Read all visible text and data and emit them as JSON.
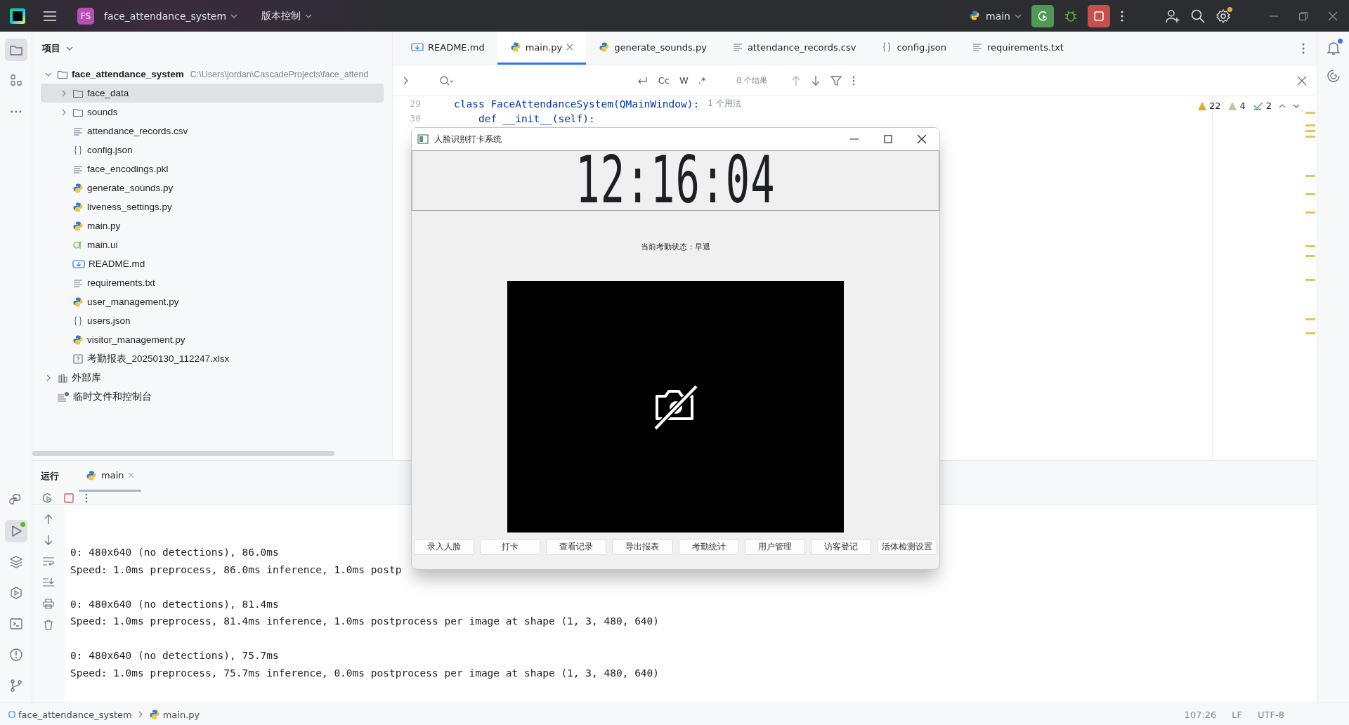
{
  "top_bar": {
    "project_badge": "FS",
    "project": "face_attendance_system",
    "vcs": "版本控制",
    "run_config": "main",
    "settings_update": true
  },
  "tool_windows": {
    "top": [
      {
        "kind": "project",
        "selected": true
      },
      {
        "kind": "structure",
        "selected": false
      },
      {
        "kind": "more",
        "selected": false
      }
    ],
    "bottom": [
      {
        "kind": "python-console",
        "selected": false,
        "running": false
      },
      {
        "kind": "run",
        "selected": true,
        "running": true
      },
      {
        "kind": "layers",
        "selected": false,
        "running": false
      },
      {
        "kind": "services",
        "selected": false,
        "running": false
      },
      {
        "kind": "terminal",
        "selected": false,
        "running": false
      },
      {
        "kind": "problems",
        "selected": false,
        "running": false
      },
      {
        "kind": "git",
        "selected": false,
        "running": false
      }
    ]
  },
  "project_panel": {
    "title": "项目",
    "tree": [
      {
        "name": "face_attendance_system",
        "path": "C:\\Users\\jordan\\CascadeProjects\\face_attend",
        "kind": "folder",
        "expanded": true,
        "selected": false,
        "children": [
          {
            "name": "face_data",
            "kind": "folder",
            "expanded": false,
            "selected": true
          },
          {
            "name": "sounds",
            "kind": "folder",
            "expanded": false,
            "selected": false
          },
          {
            "name": "attendance_records.csv",
            "kind": "text",
            "selected": false
          },
          {
            "name": "config.json",
            "kind": "json",
            "selected": false
          },
          {
            "name": "face_encodings.pkl",
            "kind": "text",
            "selected": false
          },
          {
            "name": "generate_sounds.py",
            "kind": "python",
            "selected": false
          },
          {
            "name": "liveness_settings.py",
            "kind": "python",
            "selected": false
          },
          {
            "name": "main.py",
            "kind": "python",
            "selected": false
          },
          {
            "name": "main.ui",
            "kind": "qt",
            "selected": false
          },
          {
            "name": "README.md",
            "kind": "markdown",
            "selected": false
          },
          {
            "name": "requirements.txt",
            "kind": "text",
            "selected": false
          },
          {
            "name": "user_management.py",
            "kind": "python",
            "selected": false
          },
          {
            "name": "users.json",
            "kind": "json",
            "selected": false
          },
          {
            "name": "visitor_management.py",
            "kind": "python",
            "selected": false
          },
          {
            "name": "考勤报表_20250130_112247.xlsx",
            "kind": "unknown",
            "selected": false
          }
        ]
      },
      {
        "name": "外部库",
        "kind": "library",
        "expanded": false,
        "selected": false
      },
      {
        "name": "临时文件和控制台",
        "kind": "scratch",
        "selected": false
      }
    ]
  },
  "editor": {
    "tabs": [
      {
        "label": "README.md",
        "kind": "markdown",
        "selected": false
      },
      {
        "label": "main.py",
        "kind": "python",
        "selected": true
      },
      {
        "label": "generate_sounds.py",
        "kind": "python",
        "selected": false
      },
      {
        "label": "attendance_records.csv",
        "kind": "text",
        "selected": false
      },
      {
        "label": "config.json",
        "kind": "json",
        "selected": false
      },
      {
        "label": "requirements.txt",
        "kind": "text",
        "selected": false
      }
    ],
    "find": {
      "options": [
        "Cc",
        "W",
        ".*"
      ],
      "result": "0 个结果"
    },
    "problems": [
      {
        "kind": "error",
        "count": "22"
      },
      {
        "kind": "warning",
        "count": "4"
      },
      {
        "kind": "typo",
        "count": "2"
      }
    ],
    "code": [
      {
        "line": "29",
        "text": "class FaceAttendanceSystem(QMainWindow):",
        "hint": "1 个用法"
      },
      {
        "line": "30",
        "text": "    def __init__(self):"
      }
    ]
  },
  "run_panel": {
    "title": "运行",
    "tabs": [
      {
        "label": "main",
        "selected": true
      }
    ],
    "console": [
      [
        "0: 480x640 (no detections), 86.0ms",
        "Speed: 1.0ms preprocess, 86.0ms inference, 1.0ms postp"
      ],
      [
        "0: 480x640 (no detections), 81.4ms",
        "Speed: 1.0ms preprocess, 81.4ms inference, 1.0ms postprocess per image at shape (1, 3, 480, 640)"
      ],
      [
        "0: 480x640 (no detections), 75.7ms",
        "Speed: 1.0ms preprocess, 75.7ms inference, 0.0ms postprocess per image at shape (1, 3, 480, 640)"
      ]
    ]
  },
  "status_bar": {
    "breadcrumbs": [
      {
        "label": "face_attendance_system",
        "kind": "module"
      },
      {
        "label": "main.py",
        "kind": "python"
      }
    ],
    "position": "107:26",
    "line_ending": "LF",
    "encoding": "UTF-8"
  },
  "dialog": {
    "title": "人脸识别打卡系统",
    "clock": "12:16:04",
    "status": "当前考勤状态：早退",
    "buttons": [
      "录入人脸",
      "打卡",
      "查看记录",
      "导出报表",
      "考勤统计",
      "用户管理",
      "访客登记",
      "活体检测设置"
    ]
  }
}
